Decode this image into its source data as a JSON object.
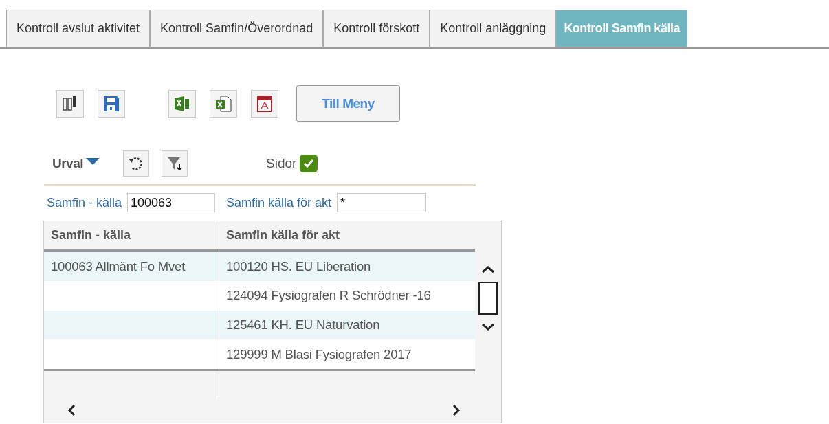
{
  "tabs": [
    {
      "label": "Kontroll avslut aktivitet",
      "selected": false
    },
    {
      "label": "Kontroll Samfin/Överordnad",
      "selected": false
    },
    {
      "label": "Kontroll förskott",
      "selected": false
    },
    {
      "label": "Kontroll anläggning",
      "selected": false
    },
    {
      "label": "Kontroll Samfin källa",
      "selected": true
    }
  ],
  "menu_button": "Till Meny",
  "selection": {
    "label": "Urval",
    "pages_label": "Sidor",
    "pages_checked": true
  },
  "filters": [
    {
      "label": "Samfin - källa",
      "value": "100063"
    },
    {
      "label": "Samfin källa för akt",
      "value": "*"
    }
  ],
  "table": {
    "columns": [
      "Samfin - källa",
      "Samfin källa för akt"
    ],
    "rows": [
      [
        "100063 Allmänt Fo Mvet",
        "100120 HS. EU Liberation"
      ],
      [
        "",
        "124094 Fysiografen R Schrödner -16"
      ],
      [
        "",
        "125461 KH. EU Naturvation"
      ],
      [
        "",
        "129999 M Blasi Fysiografen 2017"
      ]
    ]
  }
}
